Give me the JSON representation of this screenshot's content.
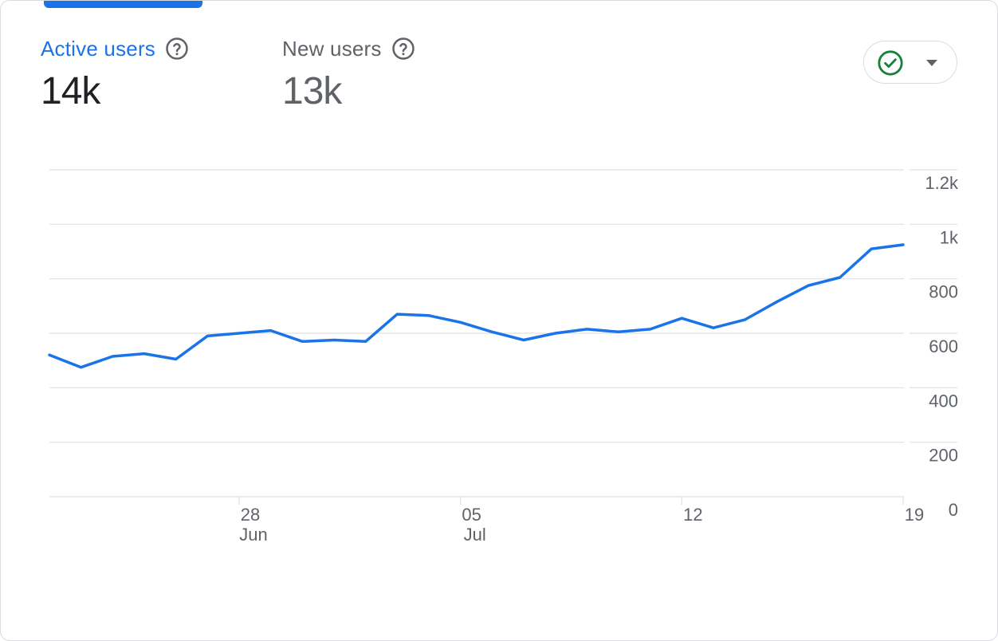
{
  "metrics": [
    {
      "label": "Active users",
      "value": "14k",
      "selected": true
    },
    {
      "label": "New users",
      "value": "13k",
      "selected": false
    }
  ],
  "compare": {
    "icon": "check-circle-icon",
    "dropdown_icon": "caret-down-icon"
  },
  "colors": {
    "accent": "#1a73e8",
    "line": "#1a73e8",
    "grid": "#e0e0e0",
    "check": "#188038",
    "muted": "#5f6368"
  },
  "chart_data": {
    "type": "line",
    "x_ticks": [
      {
        "day": "28",
        "month": "Jun",
        "index": 6
      },
      {
        "day": "05",
        "month": "Jul",
        "index": 13
      },
      {
        "day": "12",
        "month": "",
        "index": 20
      },
      {
        "day": "19",
        "month": "",
        "index": 27
      }
    ],
    "y_ticks": [
      "0",
      "200",
      "400",
      "600",
      "800",
      "1k",
      "1.2k"
    ],
    "y_tick_values": [
      0,
      200,
      400,
      600,
      800,
      1000,
      1200
    ],
    "ylim": [
      0,
      1200
    ],
    "y_axis_position": "right",
    "grid": true,
    "series": [
      {
        "values": [
          520,
          475,
          515,
          525,
          505,
          590,
          600,
          610,
          570,
          575,
          570,
          670,
          665,
          640,
          605,
          575,
          600,
          615,
          605,
          615,
          655,
          620,
          650,
          715,
          775,
          805,
          910,
          925
        ]
      }
    ]
  }
}
